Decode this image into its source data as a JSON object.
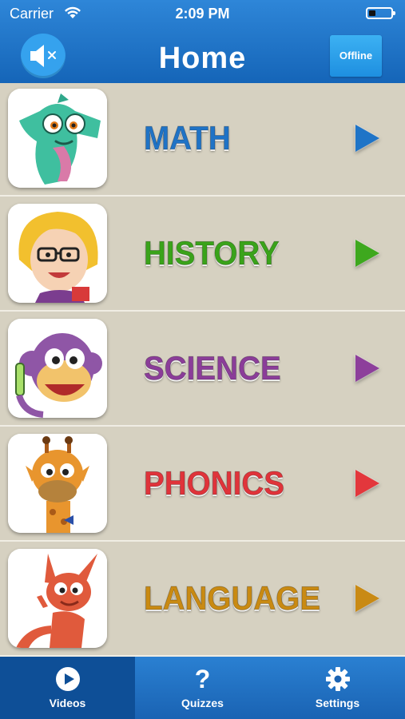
{
  "status_bar": {
    "carrier": "Carrier",
    "time": "2:09 PM"
  },
  "header": {
    "title": "Home",
    "offline_label": "Offline",
    "sound_icon": "speaker-muted-icon"
  },
  "subjects": [
    {
      "label": "MATH",
      "color": "#1f73c6",
      "arrow_color": "#1f74c7",
      "character": "seahorse"
    },
    {
      "label": "HISTORY",
      "color": "#3aa31a",
      "arrow_color": "#3ea81e",
      "character": "teacher"
    },
    {
      "label": "SCIENCE",
      "color": "#8b3d99",
      "arrow_color": "#8d3f9b",
      "character": "monkey"
    },
    {
      "label": "PHONICS",
      "color": "#e0333a",
      "arrow_color": "#e3373c",
      "character": "giraffe"
    },
    {
      "label": "LANGUAGE",
      "color": "#c98a12",
      "arrow_color": "#c98a14",
      "character": "kangaroo"
    }
  ],
  "tabbar": {
    "tabs": [
      {
        "label": "Videos",
        "icon": "play-circle-icon",
        "active": true
      },
      {
        "label": "Quizzes",
        "icon": "question-mark-icon",
        "glyph": "?",
        "active": false
      },
      {
        "label": "Settings",
        "icon": "gear-icon",
        "active": false
      }
    ]
  }
}
